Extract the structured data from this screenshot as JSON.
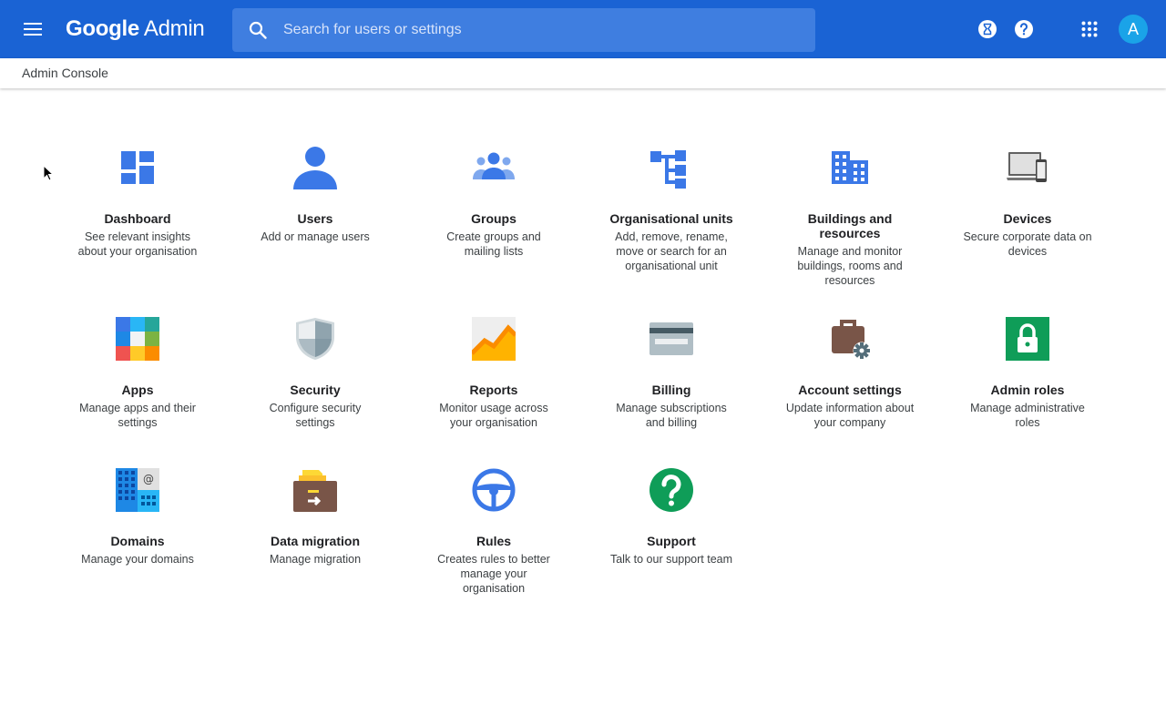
{
  "header": {
    "logo_brand": "Google",
    "logo_product": "Admin",
    "search_placeholder": "Search for users or settings",
    "avatar_letter": "A"
  },
  "breadcrumb": {
    "label": "Admin Console"
  },
  "colors": {
    "topbar": "#1a63d4",
    "search_bg": "#3f7ee0",
    "icon_blue": "#3b78e7",
    "avatar": "#1aa3e8"
  },
  "tiles": [
    {
      "title": "Dashboard",
      "description": "See relevant insights about your organisation",
      "icon": "dashboard-icon"
    },
    {
      "title": "Users",
      "description": "Add or manage users",
      "icon": "user-icon"
    },
    {
      "title": "Groups",
      "description": "Create groups and mailing lists",
      "icon": "groups-icon"
    },
    {
      "title": "Organisational units",
      "description": "Add, remove, rename, move or search for an organisational unit",
      "icon": "org-units-icon"
    },
    {
      "title": "Buildings and resources",
      "description": "Manage and monitor buildings, rooms and resources",
      "icon": "building-icon"
    },
    {
      "title": "Devices",
      "description": "Secure corporate data on devices",
      "icon": "devices-icon"
    },
    {
      "title": "Apps",
      "description": "Manage apps and their settings",
      "icon": "apps-icon"
    },
    {
      "title": "Security",
      "description": "Configure security settings",
      "icon": "shield-icon"
    },
    {
      "title": "Reports",
      "description": "Monitor usage across your organisation",
      "icon": "reports-icon"
    },
    {
      "title": "Billing",
      "description": "Manage subscriptions and billing",
      "icon": "credit-card-icon"
    },
    {
      "title": "Account settings",
      "description": "Update information about your company",
      "icon": "briefcase-gear-icon"
    },
    {
      "title": "Admin roles",
      "description": "Manage administrative roles",
      "icon": "lock-icon"
    },
    {
      "title": "Domains",
      "description": "Manage your domains",
      "icon": "domains-icon"
    },
    {
      "title": "Data migration",
      "description": "Manage migration",
      "icon": "data-migration-icon"
    },
    {
      "title": "Rules",
      "description": "Creates rules to better manage your organisation",
      "icon": "steering-wheel-icon"
    },
    {
      "title": "Support",
      "description": "Talk to our support team",
      "icon": "help-circle-icon"
    }
  ]
}
